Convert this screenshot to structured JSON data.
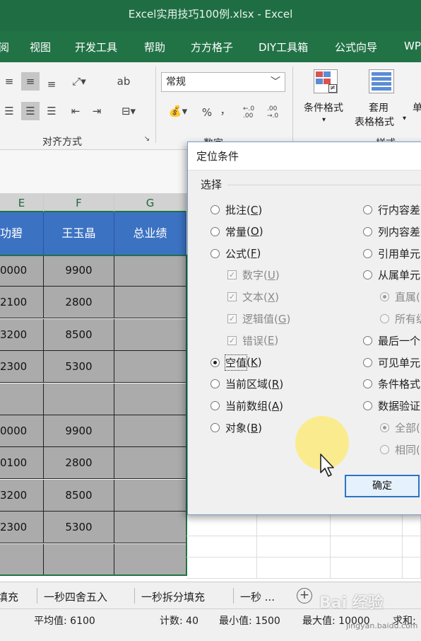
{
  "window": {
    "title": "Excel实用技巧100例.xlsx  -  Excel"
  },
  "menu": [
    "阅",
    "视图",
    "开发工具",
    "帮助",
    "方方格子",
    "DIY工具箱",
    "公式向导",
    "WP"
  ],
  "ribbon": {
    "number_format": "常规",
    "percent_symbol": "%",
    "comma_symbol": "，",
    "inc_decimal": "←.0 .00",
    "dec_decimal": ".00 →.0",
    "group_align": "对齐方式",
    "group_number": "数字",
    "group_styles": "样式",
    "cond_format": "条件格式",
    "table_format_1": "套用",
    "table_format_2": "表格格式",
    "cell_styles": "单"
  },
  "grid": {
    "columns": [
      "E",
      "F",
      "G"
    ],
    "headers": [
      "功碧",
      "王玉晶",
      "总业绩"
    ],
    "rows": [
      [
        "0000",
        "9900",
        ""
      ],
      [
        "2100",
        "2800",
        ""
      ],
      [
        "3200",
        "8500",
        ""
      ],
      [
        "2300",
        "5300",
        ""
      ],
      [
        "",
        "",
        ""
      ],
      [
        "0000",
        "9900",
        ""
      ],
      [
        "0100",
        "2800",
        ""
      ],
      [
        "3200",
        "8500",
        ""
      ],
      [
        "2300",
        "5300",
        ""
      ],
      [
        "",
        "",
        ""
      ]
    ]
  },
  "dialog": {
    "title": "定位条件",
    "section": "选择",
    "left_options": [
      {
        "label": "批注",
        "key": "C",
        "type": "radio",
        "checked": false,
        "disabled": false
      },
      {
        "label": "常量",
        "key": "O",
        "type": "radio",
        "checked": false,
        "disabled": false
      },
      {
        "label": "公式",
        "key": "F",
        "type": "radio",
        "checked": false,
        "disabled": false
      },
      {
        "label": "数字",
        "key": "U",
        "type": "check",
        "checked": true,
        "disabled": true
      },
      {
        "label": "文本",
        "key": "X",
        "type": "check",
        "checked": true,
        "disabled": true
      },
      {
        "label": "逻辑值",
        "key": "G",
        "type": "check",
        "checked": true,
        "disabled": true
      },
      {
        "label": "错误",
        "key": "E",
        "type": "check",
        "checked": true,
        "disabled": true
      },
      {
        "label": "空值",
        "key": "K",
        "type": "radio",
        "checked": true,
        "disabled": false
      },
      {
        "label": "当前区域",
        "key": "R",
        "type": "radio",
        "checked": false,
        "disabled": false
      },
      {
        "label": "当前数组",
        "key": "A",
        "type": "radio",
        "checked": false,
        "disabled": false
      },
      {
        "label": "对象",
        "key": "B",
        "type": "radio",
        "checked": false,
        "disabled": false
      }
    ],
    "right_options": [
      {
        "label": "行内容差",
        "type": "radio",
        "checked": false,
        "disabled": false
      },
      {
        "label": "列内容差",
        "type": "radio",
        "checked": false,
        "disabled": false
      },
      {
        "label": "引用单元",
        "type": "radio",
        "checked": false,
        "disabled": false
      },
      {
        "label": "从属单元",
        "type": "radio",
        "checked": false,
        "disabled": false
      },
      {
        "label": "直属(",
        "type": "radio",
        "checked": true,
        "disabled": true
      },
      {
        "label": "所有级",
        "type": "radio",
        "checked": false,
        "disabled": true
      },
      {
        "label": "最后一个",
        "type": "radio",
        "checked": false,
        "disabled": false
      },
      {
        "label": "可见单元",
        "type": "radio",
        "checked": false,
        "disabled": false
      },
      {
        "label": "条件格式",
        "type": "radio",
        "checked": false,
        "disabled": false
      },
      {
        "label": "数据验证",
        "type": "radio",
        "checked": false,
        "disabled": false
      },
      {
        "label": "全部(",
        "type": "radio",
        "checked": true,
        "disabled": true
      },
      {
        "label": "相同(",
        "type": "radio",
        "checked": false,
        "disabled": true
      }
    ],
    "ok_label": "确定"
  },
  "sheet_tabs": [
    "填充",
    "一秒四舍五入",
    "一秒拆分填充",
    "一秒 ..."
  ],
  "status": {
    "average": "平均值: 6100",
    "count": "计数: 40",
    "min": "最小值: 1500",
    "max": "最大值: 10000",
    "sum": "求和:"
  },
  "watermark": {
    "brand": "Bai 经验",
    "site": "jingyan.baidu.com"
  },
  "colors": {
    "excel_green": "#217346",
    "header_blue": "#3c72c2",
    "selection_gray": "#ababab",
    "dialog_border": "#2c73c8"
  }
}
